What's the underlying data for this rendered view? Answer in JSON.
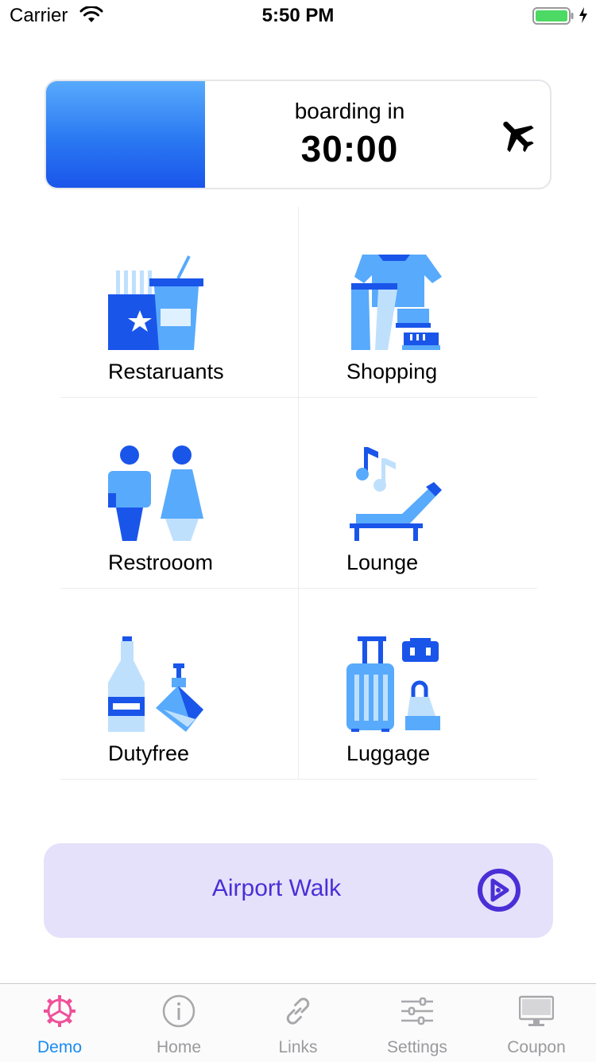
{
  "status_bar": {
    "carrier": "Carrier",
    "time": "5:50 PM"
  },
  "boarding": {
    "label": "boarding in",
    "countdown": "30:00",
    "icon": "airplane-icon"
  },
  "categories": [
    {
      "label": "Restaruants",
      "icon": "restaurant-icon"
    },
    {
      "label": "Shopping",
      "icon": "shopping-icon"
    },
    {
      "label": "Restrooom",
      "icon": "restroom-icon"
    },
    {
      "label": "Lounge",
      "icon": "lounge-icon"
    },
    {
      "label": "Dutyfree",
      "icon": "dutyfree-icon"
    },
    {
      "label": "Luggage",
      "icon": "luggage-icon"
    }
  ],
  "airport_walk": {
    "label": "Airport Walk",
    "icon": "play-circle-icon"
  },
  "tabs": [
    {
      "label": "Demo",
      "icon": "gear-icon",
      "active": true
    },
    {
      "label": "Home",
      "icon": "info-icon",
      "active": false
    },
    {
      "label": "Links",
      "icon": "link-icon",
      "active": false
    },
    {
      "label": "Settings",
      "icon": "sliders-icon",
      "active": false
    },
    {
      "label": "Coupon",
      "icon": "monitor-icon",
      "active": false
    }
  ],
  "colors": {
    "accent_blue": "#1a55ea",
    "light_blue": "#58aafc",
    "walk_bg": "#e5e1fa",
    "walk_text": "#4a2fd6",
    "tab_active": "#1a8cf0",
    "demo_icon": "#f0509a"
  }
}
